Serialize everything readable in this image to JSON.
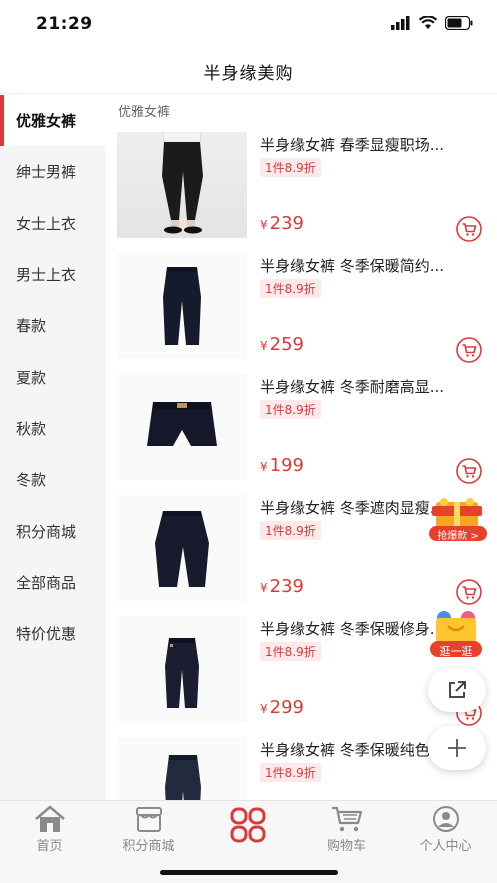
{
  "status": {
    "time": "21:29"
  },
  "header": {
    "title": "半身缘美购"
  },
  "sidebar": {
    "items": [
      {
        "label": "优雅女裤",
        "active": true
      },
      {
        "label": "绅士男裤"
      },
      {
        "label": "女士上衣"
      },
      {
        "label": "男士上衣"
      },
      {
        "label": "春款"
      },
      {
        "label": "夏款"
      },
      {
        "label": "秋款"
      },
      {
        "label": "冬款"
      },
      {
        "label": "积分商城"
      },
      {
        "label": "全部商品"
      },
      {
        "label": "特价优惠"
      }
    ]
  },
  "main": {
    "section_title": "优雅女裤",
    "currency": "¥",
    "products": [
      {
        "title": "半身缘女裤 春季显瘦职场...",
        "badge": "1件8.9折",
        "price": "239"
      },
      {
        "title": "半身缘女裤 冬季保暖简约...",
        "badge": "1件8.9折",
        "price": "259"
      },
      {
        "title": "半身缘女裤 冬季耐磨高显...",
        "badge": "1件8.9折",
        "price": "199"
      },
      {
        "title": "半身缘女裤 冬季遮肉显瘦...",
        "badge": "1件8.9折",
        "price": "239"
      },
      {
        "title": "半身缘女裤 冬季保暖修身...",
        "badge": "1件8.9折",
        "price": "299"
      },
      {
        "title": "半身缘女裤 冬季保暖纯色...",
        "badge": "1件8.9折",
        "price": ""
      }
    ]
  },
  "floating": {
    "deal_label": "抢爆款 >",
    "shop_label": "逛一逛"
  },
  "tabbar": {
    "items": [
      {
        "label": "首页",
        "icon": "home-icon"
      },
      {
        "label": "积分商城",
        "icon": "store-icon"
      },
      {
        "label": "",
        "icon": "category-icon"
      },
      {
        "label": "购物车",
        "icon": "cart-icon"
      },
      {
        "label": "个人中心",
        "icon": "user-icon"
      }
    ]
  },
  "colors": {
    "accent": "#d93a3a",
    "badge_bg": "#fde9e9",
    "sidebar_bg": "#f5f5f5"
  }
}
